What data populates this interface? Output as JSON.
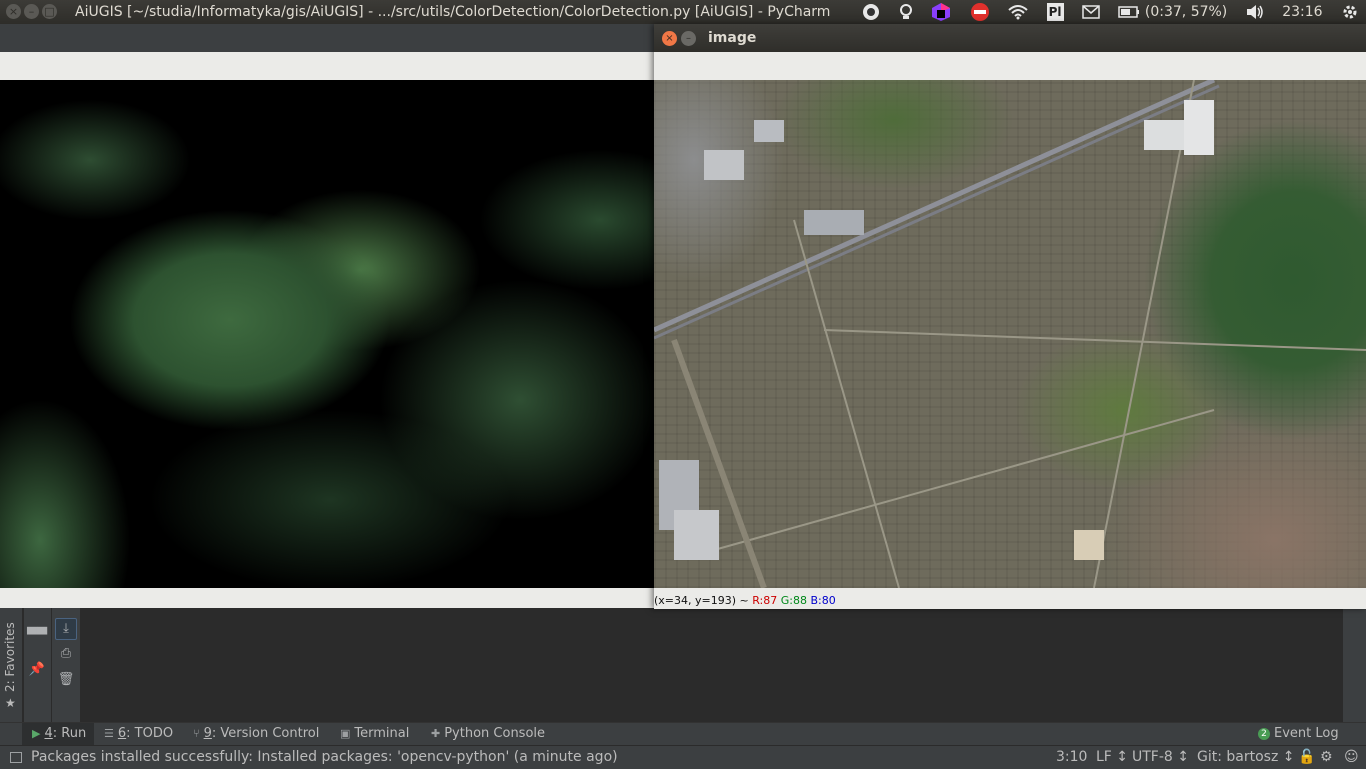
{
  "system_bar": {
    "window_title": "AiUGIS [~/studia/Informatyka/gis/AiUGIS] - .../src/utils/ColorDetection/ColorDetection.py [AiUGIS] - PyCharm",
    "battery": "(0:37, 57%)",
    "clock": "23:16",
    "tray_icons": [
      "screenshot-icon",
      "lightbulb-icon",
      "jetbrains-toolbox-icon",
      "no-entry-icon",
      "wifi-icon",
      "pycharm-icon",
      "mail-icon",
      "battery-icon",
      "volume-icon",
      "settings-gear-icon"
    ],
    "pycharm_tray_label": "Pl"
  },
  "image_window": {
    "title": "image",
    "status_prefix": "(x=34, y=193) ~",
    "r": "R:87",
    "g": "G:88",
    "b": "B:80"
  },
  "left_panel": {
    "favorites_label": "2: Favorites"
  },
  "tool_tabs": [
    {
      "num": "4",
      "label": ": Run",
      "icon": "run-icon"
    },
    {
      "num": "6",
      "label": ": TODO",
      "icon": "todo-icon"
    },
    {
      "num": "9",
      "label": ": Version Control",
      "icon": "vcs-icon"
    },
    {
      "num": "",
      "label": "Terminal",
      "icon": "terminal-icon"
    },
    {
      "num": "",
      "label": "Python Console",
      "icon": "python-console-icon"
    }
  ],
  "event_log": {
    "badge": "2",
    "label": "Event Log"
  },
  "status_bar": {
    "message": "Packages installed successfully: Installed packages: 'opencv-python' (a minute ago)",
    "position": "3:10",
    "line_sep": "LF ↕",
    "encoding": "UTF-8 ↕",
    "git": "Git: bartosz ↕"
  },
  "colors": {
    "accent_close": "#f07746",
    "ide_bg": "#2b2b2b",
    "ide_panel": "#3c3f41"
  }
}
